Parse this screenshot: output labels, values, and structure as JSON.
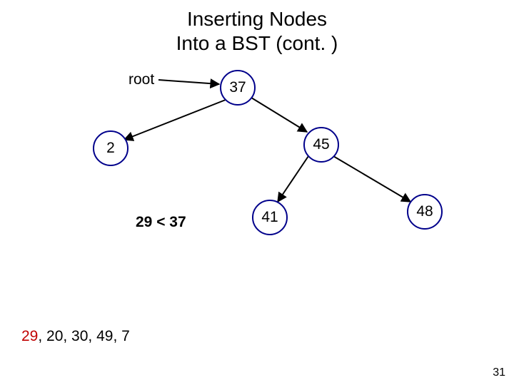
{
  "title_line1": "Inserting Nodes",
  "title_line2": "Into a BST (cont. )",
  "root_label": "root",
  "nodes": {
    "n37": "37",
    "n2": "2",
    "n45": "45",
    "n41": "41",
    "n48": "48"
  },
  "comparison": "29 < 37",
  "queue_prefix_red": "29",
  "queue_rest": ", 20, 30, 49, 7",
  "page_number": "31",
  "chart_data": {
    "type": "tree-diagram",
    "tree": {
      "value": 37,
      "left": {
        "value": 2,
        "left": null,
        "right": null
      },
      "right": {
        "value": 45,
        "left": {
          "value": 41,
          "left": null,
          "right": null
        },
        "right": {
          "value": 48,
          "left": null,
          "right": null
        }
      }
    },
    "root_label": "root",
    "current_comparison": "29 < 37",
    "insert_queue": [
      29,
      20,
      30,
      49,
      7
    ],
    "current_insert_value": 29
  }
}
